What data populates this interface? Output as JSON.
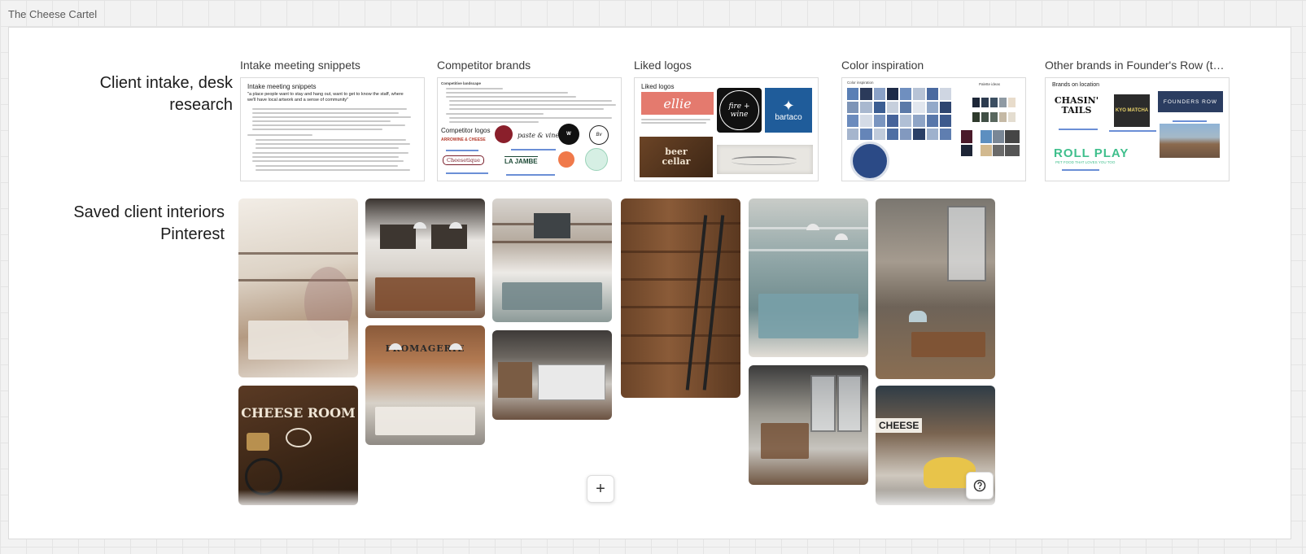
{
  "board": {
    "title": "The Cheese Cartel"
  },
  "rows": {
    "research_label": "Client intake, desk research",
    "interiors_label_line1": "Saved client interiors",
    "interiors_label_line2": "Pinterest"
  },
  "sections": {
    "intake": {
      "title": "Intake meeting snippets",
      "card_heading": "Intake meeting snippets",
      "quote": "\"a place people want to stay and hang out, want to get to know the staff, where we'll have local artwork and a sense of community\""
    },
    "competitor": {
      "title": "Competitor brands",
      "heading": "Competitive landscape",
      "logos_heading": "Competitor logos",
      "logo_names": [
        "ARROWINE & CHEESE",
        "Cheesetique",
        "LA JAMBE",
        "paste & vine"
      ]
    },
    "liked": {
      "title": "Liked logos",
      "heading": "Liked logos",
      "logo_names": [
        "ellie",
        "fire + wine",
        "bartaco",
        "beer cellar"
      ]
    },
    "color": {
      "title": "Color inspiration",
      "heading": "Color inspiration",
      "palette_label": "Palette ideas"
    },
    "founders": {
      "title": "Other brands in Founder's Row (t…",
      "heading": "Brands on location",
      "logo_names": [
        "CHASIN' TAILS",
        "KYO MATCHA",
        "FOUNDERS ROW",
        "ROLL PLAY"
      ],
      "roll_play_tagline": "PET FOOD THAT LOVES YOU TOO"
    }
  },
  "interiors": {
    "cheese_room_sign": "CHEESE ROOM",
    "fromagerie_sign": "FROMAGERIE",
    "cheese_sign": "CHEESE"
  },
  "controls": {
    "add_icon": "plus-icon",
    "help_icon": "help-icon"
  },
  "colors": {
    "ellie": "#e47a6e",
    "bartaco": "#1f5c9a",
    "founders_navy": "#2b3d61",
    "roll_play_green": "#3fbf8c",
    "kyo_matcha": "#2b2b2b"
  }
}
